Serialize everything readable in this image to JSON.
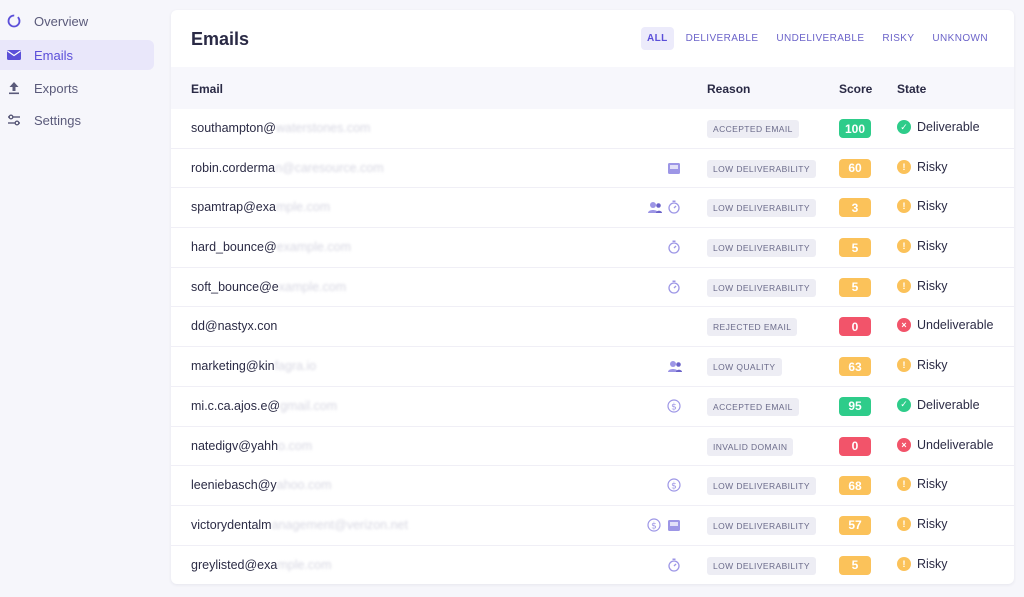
{
  "sidebar": {
    "items": [
      {
        "label": "Overview",
        "icon": "overview-ring-icon"
      },
      {
        "label": "Emails",
        "icon": "mail-icon",
        "active": true
      },
      {
        "label": "Exports",
        "icon": "upload-icon"
      },
      {
        "label": "Settings",
        "icon": "sliders-icon"
      }
    ]
  },
  "main": {
    "title": "Emails",
    "filters": [
      {
        "label": "ALL",
        "active": true
      },
      {
        "label": "DELIVERABLE"
      },
      {
        "label": "UNDELIVERABLE"
      },
      {
        "label": "RISKY"
      },
      {
        "label": "UNKNOWN"
      }
    ],
    "columns": {
      "email": "Email",
      "reason": "Reason",
      "score": "Score",
      "state": "State"
    },
    "rows": [
      {
        "email": "southampton@",
        "email_rest": "waterstones.com",
        "reason": "ACCEPTED EMAIL",
        "score": "100",
        "state": "Deliverable",
        "kind": "ok",
        "icons": []
      },
      {
        "email": "robin.corderma",
        "email_rest": "n@caresource.com",
        "reason": "LOW DELIVERABILITY",
        "score": "60",
        "state": "Risky",
        "kind": "risk",
        "icons": [
          "inbox"
        ]
      },
      {
        "email": "spamtrap@exa",
        "email_rest": "mple.com",
        "reason": "LOW DELIVERABILITY",
        "score": "3",
        "state": "Risky",
        "kind": "risk",
        "icons": [
          "timer",
          "users"
        ]
      },
      {
        "email": "hard_bounce@",
        "email_rest": "example.com",
        "reason": "LOW DELIVERABILITY",
        "score": "5",
        "state": "Risky",
        "kind": "risk",
        "icons": [
          "timer"
        ]
      },
      {
        "email": "soft_bounce@e",
        "email_rest": "xample.com",
        "reason": "LOW DELIVERABILITY",
        "score": "5",
        "state": "Risky",
        "kind": "risk",
        "icons": [
          "timer"
        ]
      },
      {
        "email": "dd@nastyx.con",
        "email_rest": "",
        "reason": "REJECTED EMAIL",
        "score": "0",
        "state": "Undeliverable",
        "kind": "bad",
        "icons": []
      },
      {
        "email": "marketing@kin",
        "email_rest": "fagra.io",
        "reason": "LOW QUALITY",
        "score": "63",
        "state": "Risky",
        "kind": "risk",
        "icons": [
          "users"
        ]
      },
      {
        "email": "mi.c.ca.ajos.e@",
        "email_rest": "gmail.com",
        "reason": "ACCEPTED EMAIL",
        "score": "95",
        "state": "Deliverable",
        "kind": "ok",
        "icons": [
          "dollar"
        ]
      },
      {
        "email": "natedigv@yahh",
        "email_rest": "o.com",
        "reason": "INVALID DOMAIN",
        "score": "0",
        "state": "Undeliverable",
        "kind": "bad",
        "icons": []
      },
      {
        "email": "leeniebasch@y",
        "email_rest": "ahoo.com",
        "reason": "LOW DELIVERABILITY",
        "score": "68",
        "state": "Risky",
        "kind": "risk",
        "icons": [
          "dollar"
        ]
      },
      {
        "email": "victorydentalm",
        "email_rest": "anagement@verizon.net",
        "reason": "LOW DELIVERABILITY",
        "score": "57",
        "state": "Risky",
        "kind": "risk",
        "icons": [
          "inbox",
          "dollar"
        ]
      },
      {
        "email": "greylisted@exa",
        "email_rest": "mple.com",
        "reason": "LOW DELIVERABILITY",
        "score": "5",
        "state": "Risky",
        "kind": "risk",
        "icons": [
          "timer"
        ]
      }
    ]
  },
  "colors": {
    "accent": "#5b4fd9",
    "ok": "#2ecc8a",
    "risk": "#fbc25a",
    "bad": "#f2546a",
    "icon": "#9d96e6"
  }
}
